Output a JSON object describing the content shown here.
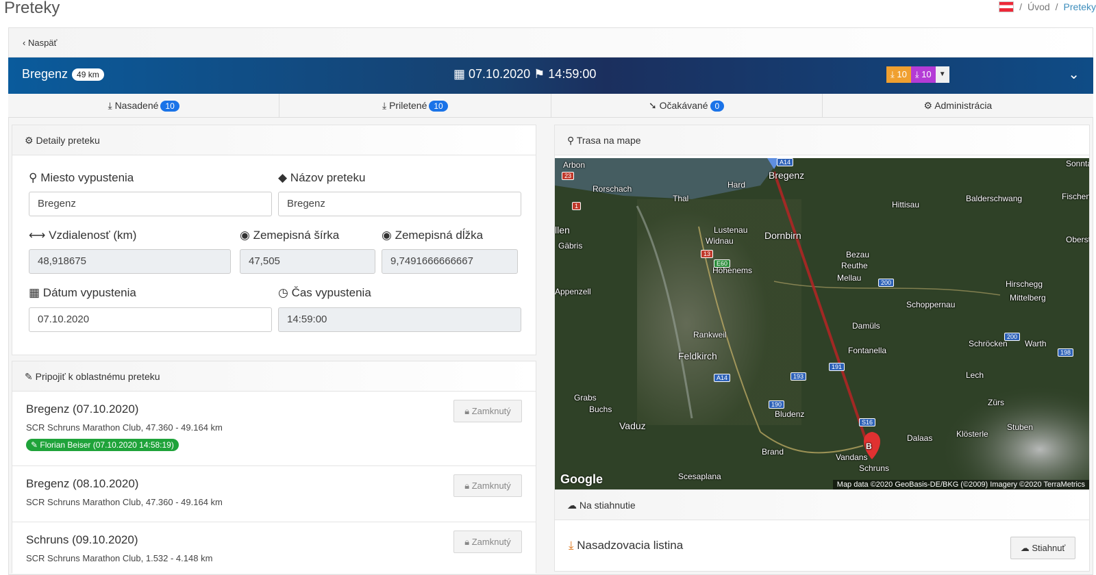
{
  "header": {
    "title": "Preteky"
  },
  "breadcrumb": {
    "sep": "/",
    "home": "Úvod",
    "current": "Preteky"
  },
  "back": {
    "label": "Naspäť"
  },
  "race": {
    "name": "Bregenz",
    "distance_badge": "49 km",
    "date": "07.10.2020",
    "time": "14:59:00",
    "count_orange": "10",
    "count_purple": "10"
  },
  "tabs": [
    {
      "label": "Nasadené",
      "count": "10"
    },
    {
      "label": "Priletené",
      "count": "10"
    },
    {
      "label": "Očakávané",
      "count": "0"
    },
    {
      "label": "Administrácia"
    }
  ],
  "details": {
    "heading": "Detaily preteku",
    "release_place": {
      "label": "Miesto vypustenia",
      "value": "Bregenz"
    },
    "race_name": {
      "label": "Názov preteku",
      "value": "Bregenz"
    },
    "distance": {
      "label": "Vzdialenosť (km)",
      "value": "48,918675"
    },
    "latitude": {
      "label": "Zemepisná šírka",
      "value": "47,505"
    },
    "longitude": {
      "label": "Zemepisná dĺžka",
      "value": "9,7491666666667"
    },
    "release_date": {
      "label": "Dátum vypustenia",
      "value": "07.10.2020"
    },
    "release_time": {
      "label": "Čas vypustenia",
      "value": "14:59:00"
    }
  },
  "regional": {
    "heading": "Pripojiť k oblastnému preteku",
    "lock_label": "Zamknutý",
    "items": [
      {
        "title": "Bregenz (07.10.2020)",
        "sub": "SCR Schruns Marathon Club, 47.360 - 49.164 km",
        "pill": "Florian Beiser (07.10.2020 14:58:19)"
      },
      {
        "title": "Bregenz (08.10.2020)",
        "sub": "SCR Schruns Marathon Club, 47.360 - 49.164 km"
      },
      {
        "title": "Schruns (09.10.2020)",
        "sub": "SCR Schruns Marathon Club, 1.532 - 4.148 km"
      }
    ]
  },
  "map": {
    "heading": "Trasa na mape",
    "labels": [
      "Arbon",
      "Rorschach",
      "Thal",
      "Hard",
      "Bregenz",
      "Hittisau",
      "Balderschwang",
      "Lustenau",
      "Widnau",
      "Dornbirn",
      "Gäbris",
      "Hohenems",
      "Bezau",
      "Reuthe",
      "Mellau",
      "Hirschegg",
      "Mittelberg",
      "Schoppernau",
      "Rankweil",
      "Damüls",
      "Schröcken",
      "Warth",
      "Feldkirch",
      "Fontanella",
      "Lech",
      "Grabs",
      "Buchs",
      "Zürs",
      "Vaduz",
      "Bludenz",
      "Klösterle",
      "Stuben",
      "Dalaas",
      "Brand",
      "Vandans",
      "Schruns",
      "Scesaplana",
      "Sonntag",
      "Fischen im Allgäu",
      "Oberstdorf",
      "Appenzell",
      "llen"
    ],
    "roads": [
      "A14",
      "23",
      "1",
      "13",
      "E60",
      "200",
      "200",
      "198",
      "193",
      "191",
      "A14",
      "190",
      "S16"
    ],
    "marker": "B",
    "google": "Google",
    "attribution": "Map data ©2020 GeoBasis-DE/BKG (©2009) Imagery ©2020 TerraMetrics"
  },
  "downloads": {
    "heading": "Na stiahnutie",
    "item": "Nasadzovacia listina",
    "button": "Stiahnuť"
  }
}
